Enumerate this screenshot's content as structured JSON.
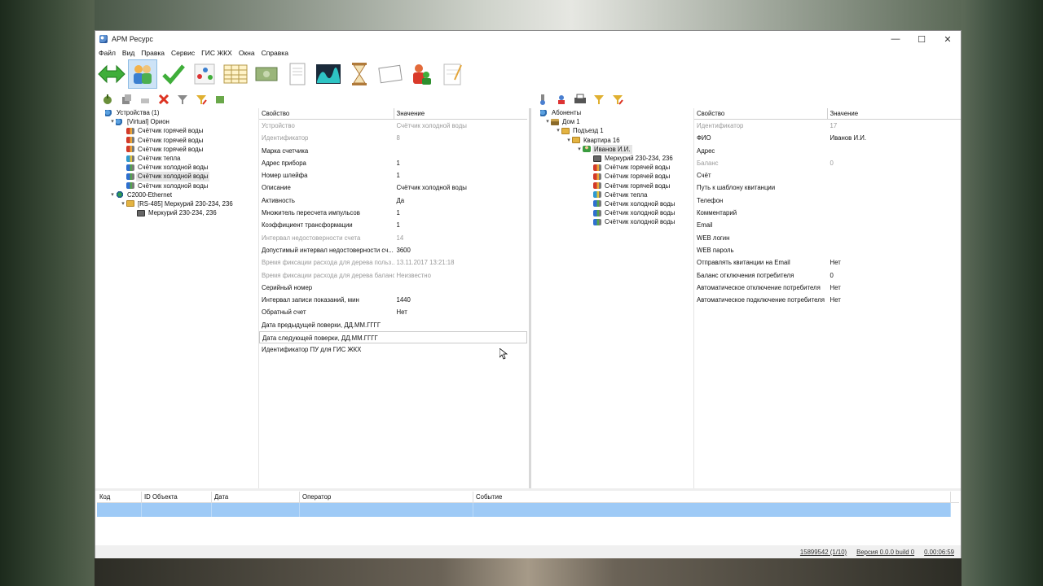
{
  "window": {
    "title": "АРМ Ресурс",
    "minimize": "—",
    "maximize": "☐",
    "close": "✕"
  },
  "menu": [
    "Файл",
    "Вид",
    "Правка",
    "Сервис",
    "ГИС ЖКХ",
    "Окна",
    "Справка"
  ],
  "devices_tree": [
    {
      "label": "Устройства (1)",
      "level": 0,
      "icon": "device",
      "expander": ""
    },
    {
      "label": "[Virtual] Орион",
      "level": 1,
      "icon": "device",
      "expander": "▾"
    },
    {
      "label": "Счётчик горячей воды",
      "level": 2,
      "icon": "hot-water"
    },
    {
      "label": "Счётчик горячей воды",
      "level": 2,
      "icon": "hot-water"
    },
    {
      "label": "Счётчик горячей воды",
      "level": 2,
      "icon": "hot-water"
    },
    {
      "label": "Счётчик тепла",
      "level": 2,
      "icon": "heat"
    },
    {
      "label": "Счётчик холодной воды",
      "level": 2,
      "icon": "cold-water"
    },
    {
      "label": "Счётчик холодной воды",
      "level": 2,
      "icon": "cold-water",
      "selected": true
    },
    {
      "label": "Счётчик холодной воды",
      "level": 2,
      "icon": "cold-water"
    },
    {
      "label": "C2000-Ethernet",
      "level": 1,
      "icon": "network",
      "expander": "▾"
    },
    {
      "label": "[RS-485] Меркурий 230-234, 236",
      "level": 2,
      "icon": "folder",
      "expander": "▾"
    },
    {
      "label": "Меркурий 230-234, 236",
      "level": 3,
      "icon": "meter"
    }
  ],
  "props_left": {
    "header": {
      "property": "Свойство",
      "value": "Значение"
    },
    "rows": [
      {
        "name": "Устройство",
        "value": "Счётчик холодной воды",
        "disabled": true
      },
      {
        "name": "Идентификатор",
        "value": "8",
        "disabled": true
      },
      {
        "name": "Марка счетчика",
        "value": ""
      },
      {
        "name": "Адрес прибора",
        "value": "1"
      },
      {
        "name": "Номер шлейфа",
        "value": "1"
      },
      {
        "name": "Описание",
        "value": "Счётчик холодной воды"
      },
      {
        "name": "Активность",
        "value": "Да"
      },
      {
        "name": "Множитель пересчета импульсов",
        "value": "1"
      },
      {
        "name": "Коэффициент трансформации",
        "value": "1"
      },
      {
        "name": "Интервал недостоверности счета",
        "value": "14",
        "disabled": true
      },
      {
        "name": "Допустимый интервал недостоверности сч...",
        "value": "3600"
      },
      {
        "name": "Время фиксации расхода для дерева польз...",
        "value": "13.11.2017 13:21:18",
        "disabled": true
      },
      {
        "name": "Время фиксации расхода для дерева баланса",
        "value": "Неизвестно",
        "disabled": true
      },
      {
        "name": "Серийный номер",
        "value": ""
      },
      {
        "name": "Интервал записи показаний, мин",
        "value": "1440"
      },
      {
        "name": "Обратный счет",
        "value": "Нет"
      },
      {
        "name": "Дата предыдущей поверки, ДД.ММ.ГГГГ",
        "value": ""
      },
      {
        "name": "Дата следующей поверки, ДД.ММ.ГГГГ",
        "value": "",
        "focused": true
      },
      {
        "name": "Идентификатор ПУ для ГИС ЖКХ",
        "value": ""
      }
    ]
  },
  "subscribers_tree": [
    {
      "label": "Абоненты",
      "level": 0,
      "icon": "device",
      "expander": ""
    },
    {
      "label": "Дом 1",
      "level": 1,
      "icon": "house",
      "expander": "▾"
    },
    {
      "label": "Подъезд 1",
      "level": 2,
      "icon": "folder",
      "expander": "▾"
    },
    {
      "label": "Квартира 16",
      "level": 3,
      "icon": "folder",
      "expander": "▾"
    },
    {
      "label": "Иванов И.И.",
      "level": 4,
      "icon": "user",
      "expander": "▾",
      "selected": true
    },
    {
      "label": "Меркурий 230-234, 236",
      "level": 5,
      "icon": "meter"
    },
    {
      "label": "Счётчик горячей воды",
      "level": 5,
      "icon": "hot-water"
    },
    {
      "label": "Счётчик горячей воды",
      "level": 5,
      "icon": "hot-water"
    },
    {
      "label": "Счётчик горячей воды",
      "level": 5,
      "icon": "hot-water"
    },
    {
      "label": "Счётчик тепла",
      "level": 5,
      "icon": "heat"
    },
    {
      "label": "Счётчик холодной воды",
      "level": 5,
      "icon": "cold-water"
    },
    {
      "label": "Счётчик холодной воды",
      "level": 5,
      "icon": "cold-water"
    },
    {
      "label": "Счётчик холодной воды",
      "level": 5,
      "icon": "cold-water"
    }
  ],
  "props_right": {
    "header": {
      "property": "Свойство",
      "value": "Значение"
    },
    "rows": [
      {
        "name": "Идентификатор",
        "value": "17",
        "disabled": true
      },
      {
        "name": "ФИО",
        "value": "Иванов И.И."
      },
      {
        "name": "Адрес",
        "value": ""
      },
      {
        "name": "Баланс",
        "value": "0",
        "disabled": true
      },
      {
        "name": "Счёт",
        "value": ""
      },
      {
        "name": "Путь к шаблону квитанции",
        "value": ""
      },
      {
        "name": "Телефон",
        "value": ""
      },
      {
        "name": "Комментарий",
        "value": ""
      },
      {
        "name": "Email",
        "value": ""
      },
      {
        "name": "WEB логин",
        "value": ""
      },
      {
        "name": "WEB пароль",
        "value": ""
      },
      {
        "name": "Отправлять квитанции на Email",
        "value": "Нет"
      },
      {
        "name": "Баланс отключения потребителя",
        "value": "0"
      },
      {
        "name": "Автоматическое отключение потребителя",
        "value": "Нет"
      },
      {
        "name": "Автоматическое подключение потребителя",
        "value": "Нет"
      }
    ]
  },
  "log": {
    "columns": [
      "Код",
      "ID Объекта",
      "Дата",
      "Оператор",
      "Событие"
    ]
  },
  "status": {
    "record": "15899542 (1/10)",
    "version": "Версия 0.0.0 build 0",
    "time": "0.00:06:59"
  },
  "colors": {
    "selection": "#9ecaf6",
    "accent": "#cde3f7"
  }
}
